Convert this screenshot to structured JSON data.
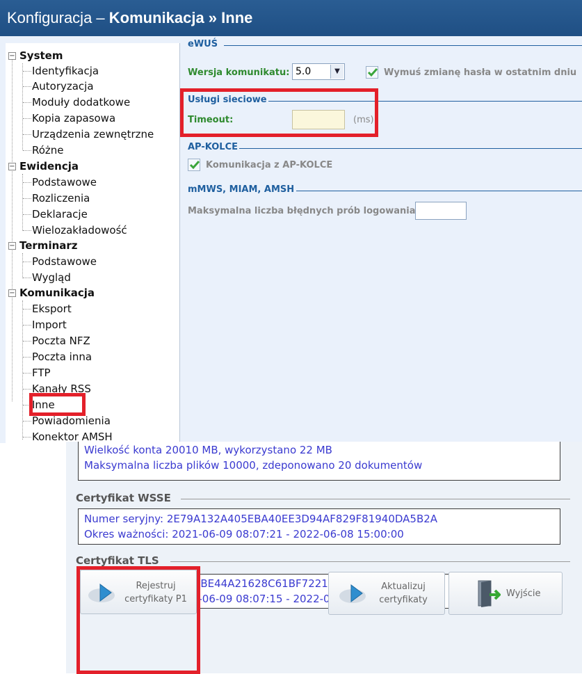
{
  "window": {
    "title_prefix": "Konfiguracja – ",
    "title_bold": "Komunikacja » Inne"
  },
  "tree": {
    "groups": [
      {
        "label": "System",
        "items": [
          "Identyfikacja",
          "Autoryzacja",
          "Moduły dodatkowe",
          "Kopia zapasowa",
          "Urządzenia zewnętrzne",
          "Różne"
        ]
      },
      {
        "label": "Ewidencja",
        "items": [
          "Podstawowe",
          "Rozliczenia",
          "Deklaracje",
          "Wielozakładowość"
        ]
      },
      {
        "label": "Terminarz",
        "items": [
          "Podstawowe",
          "Wygląd"
        ]
      },
      {
        "label": "Komunikacja",
        "items": [
          "Eksport",
          "Import",
          "Poczta NFZ",
          "Poczta inna",
          "FTP",
          "Kanały RSS",
          "Inne",
          "Powiadomienia",
          "Konektor AMSH"
        ]
      }
    ],
    "selected": "Inne"
  },
  "ewus": {
    "section": "eWUŚ",
    "version_label": "Wersja komunikatu:",
    "version_value": "5.0",
    "force_password_label": "Wymuś zmianę hasła w ostatnim dniu",
    "force_password_checked": true
  },
  "web_services": {
    "section": "Usługi sieciowe",
    "timeout_label": "Timeout:",
    "timeout_value": "",
    "timeout_unit": "(ms)"
  },
  "ap_kolce": {
    "section": "AP-KOLCE",
    "comm_label": "Komunikacja z AP-KOLCE",
    "comm_checked": true
  },
  "mmws": {
    "section": "mMWS, MIAM, AMSH",
    "max_login_label": "Maksymalna liczba błędnych prób logowania:",
    "max_login_value": ""
  },
  "account_panel": {
    "line1": "Wielkość konta 20010 MB, wykorzystano 22 MB",
    "line2": "Maksymalna liczba plików 10000, zdeponowano 20 dokumentów"
  },
  "cert_wsse": {
    "section": "Certyfikat WSSE",
    "serial": "Numer seryjny: 2E79A132A405EBA40EE3D94AF829F81940DA5B2A",
    "validity": "Okres ważności: 2021-06-09 08:07:21 - 2022-06-08 15:00:00"
  },
  "cert_tls": {
    "section": "Certyfikat TLS",
    "serial": "Numer seryjny: 3B331BE44A21628C61BF722119924B1FE159BD9A",
    "validity": "Okres ważności: 2021-06-09 08:07:15 - 2022-06-08 15:00:00"
  },
  "buttons": {
    "register_line1": "Rejestruj",
    "register_line2": "certyfikaty P1",
    "update_line1": "Aktualizuj",
    "update_line2": "certyfikaty",
    "exit": "Wyjście"
  },
  "colors": {
    "title_bar": "#1f4f84",
    "highlight": "#e3202a",
    "section_blue": "#1f5f9f",
    "label_green": "#2f8a2f",
    "panel_text": "#3a3ad0"
  }
}
